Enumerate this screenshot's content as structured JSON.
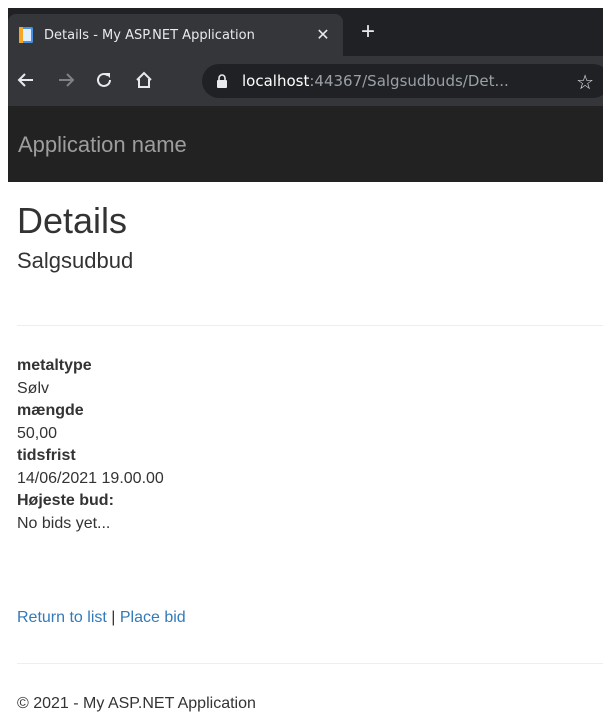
{
  "browser": {
    "tab_title": "Details - My ASP.NET Application",
    "tab_close": "✕",
    "new_tab": "+",
    "url_host": "localhost",
    "url_rest": ":44367/Salgsudbuds/Det...",
    "bookmark_star": "☆"
  },
  "navbar": {
    "brand": "Application name",
    "bg_color": "#222222",
    "brand_color": "#9d9d9d"
  },
  "page": {
    "title": "Details",
    "subtitle": "Salgsudbud"
  },
  "details": [
    {
      "label": "metaltype",
      "value": "Sølv"
    },
    {
      "label": "mængde",
      "value": "50,00"
    },
    {
      "label": "tidsfrist",
      "value": "14/06/2021 19.00.00"
    },
    {
      "label": "Højeste bud:",
      "value": "No bids yet..."
    }
  ],
  "actions": {
    "return_label": "Return to list",
    "separator": " | ",
    "place_bid_label": "Place bid",
    "link_color": "#337ab7"
  },
  "footer": {
    "text": "© 2021 - My ASP.NET Application"
  },
  "icons": {
    "favicon": "document-icon",
    "back": "arrow-left-icon",
    "forward": "arrow-right-icon",
    "reload": "reload-icon",
    "home": "home-icon",
    "lock": "lock-icon",
    "star": "star-outline-icon"
  }
}
